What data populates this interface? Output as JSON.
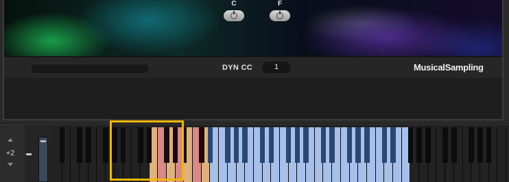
{
  "controls": {
    "knob_c": {
      "label": "C"
    },
    "knob_f": {
      "label": "F"
    }
  },
  "bar": {
    "dyn_label": "DYN CC",
    "dyn_value": "1",
    "brand": "MusicalSampling"
  },
  "keyboard": {
    "octave_shift": "+2",
    "white_key_count": 52,
    "keyswitch_range": {
      "first": 11,
      "last": 17
    },
    "playable_range": {
      "first": 18,
      "last": 40
    },
    "colors": {
      "key_off": "#222222",
      "keyswitch_white": "#d98989",
      "keyswitch_white_alt": "#dfb27c",
      "playable_white": "#a7c0ea",
      "playable_black": "#2a4672",
      "highlight_border": "#f2b705"
    }
  }
}
